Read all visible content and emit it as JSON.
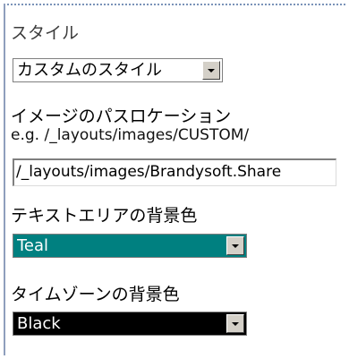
{
  "style_section": {
    "label": "スタイル",
    "selected": "カスタムのスタイル"
  },
  "image_location": {
    "label": "イメージのパスロケーション",
    "example": "e.g. /_layouts/images/CUSTOM/",
    "value": "/_layouts/images/Brandysoft.Share"
  },
  "textarea_bg": {
    "label": "テキストエリアの背景色",
    "selected": "Teal",
    "color": "#008080"
  },
  "timezone_bg": {
    "label": "タイムゾーンの背景色",
    "selected": "Black",
    "color": "#000000"
  },
  "icons": [
    "chevron-down-icon"
  ]
}
